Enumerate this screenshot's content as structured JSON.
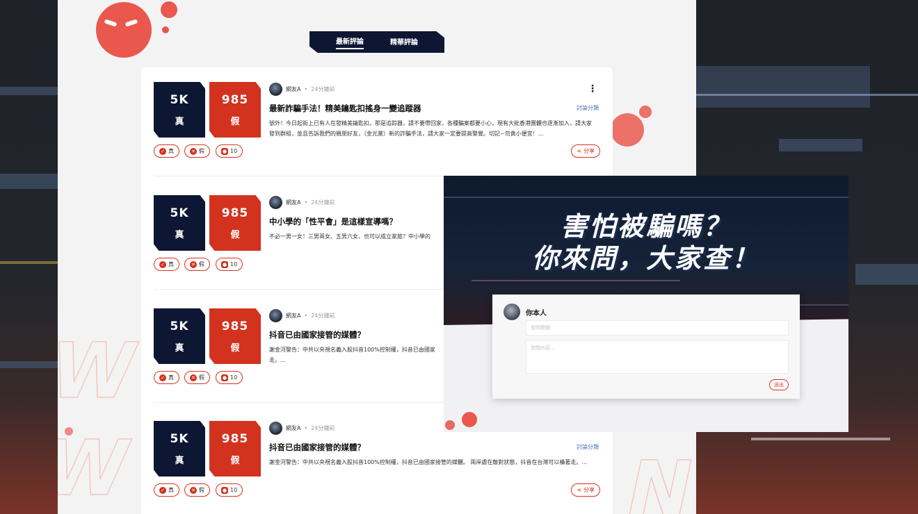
{
  "tabs": [
    {
      "label": "最新評論",
      "active": true
    },
    {
      "label": "精華評論",
      "active": false
    }
  ],
  "posts": [
    {
      "true_count": "5K",
      "true_label": "真",
      "false_count": "985",
      "false_label": "假",
      "author": "網友A",
      "separator": "•",
      "time": "24分鐘前",
      "title": "最新詐騙手法！精美鑰匙扣搖身一變追蹤器",
      "category": "討論分類",
      "excerpt": "號外！今日起街上已有人在發精美鑰匙扣，那是追踪器，請不要帶回家，各種騙案都要小心，現有大批香港團體也逐漸加入，請大家發到群組，並且告訴我們的親朋好友，（金光黨）新的詐騙手法，請大家一定要提高警覺。切記~勿貪小便宜！…",
      "btn_true": "真",
      "btn_false": "假",
      "comments": "10",
      "share": "分享"
    },
    {
      "true_count": "5K",
      "true_label": "真",
      "false_count": "985",
      "false_label": "假",
      "author": "網友A",
      "separator": "•",
      "time": "24分鐘前",
      "title": "中小學的「性平會」是這樣宣導嗎？",
      "category": "",
      "excerpt": "不必一男一女！三男兩女、五男六女、也可以成立家庭？中小學的",
      "btn_true": "真",
      "btn_false": "假",
      "comments": "10",
      "share": ""
    },
    {
      "true_count": "5K",
      "true_label": "真",
      "false_count": "985",
      "false_label": "假",
      "author": "網友A",
      "separator": "•",
      "time": "24分鐘前",
      "title": "抖音已由國家接管的媒體？",
      "category": "",
      "excerpt": "謝金河警告：中共以央視名義入股抖音100%控制權，抖音已由國家 走。…",
      "btn_true": "真",
      "btn_false": "假",
      "comments": "10",
      "share": ""
    },
    {
      "true_count": "5K",
      "true_label": "真",
      "false_count": "985",
      "false_label": "假",
      "author": "網友A",
      "separator": "•",
      "time": "24分鐘前",
      "title": "抖音已由國家接管的媒體？",
      "category": "討論分類",
      "excerpt": "謝金河警告：中共以央視名義入股抖音100%控制權，抖音已由國家接管的媒體。 兩岸處在敵對狀態，抖音在台灣可以橫著走。…",
      "btn_true": "真",
      "btn_false": "假",
      "comments": "10",
      "share": "分享"
    }
  ],
  "overlay": {
    "headline_line1": "害怕被騙嗎？",
    "headline_line2": "你來問，大家查！",
    "user_name": "你本人",
    "title_placeholder": "發問標題",
    "content_placeholder": "發問內容...",
    "submit_label": "送出"
  },
  "colors": {
    "navy": "#0d1733",
    "red": "#d3321f",
    "link": "#4d74b8"
  }
}
